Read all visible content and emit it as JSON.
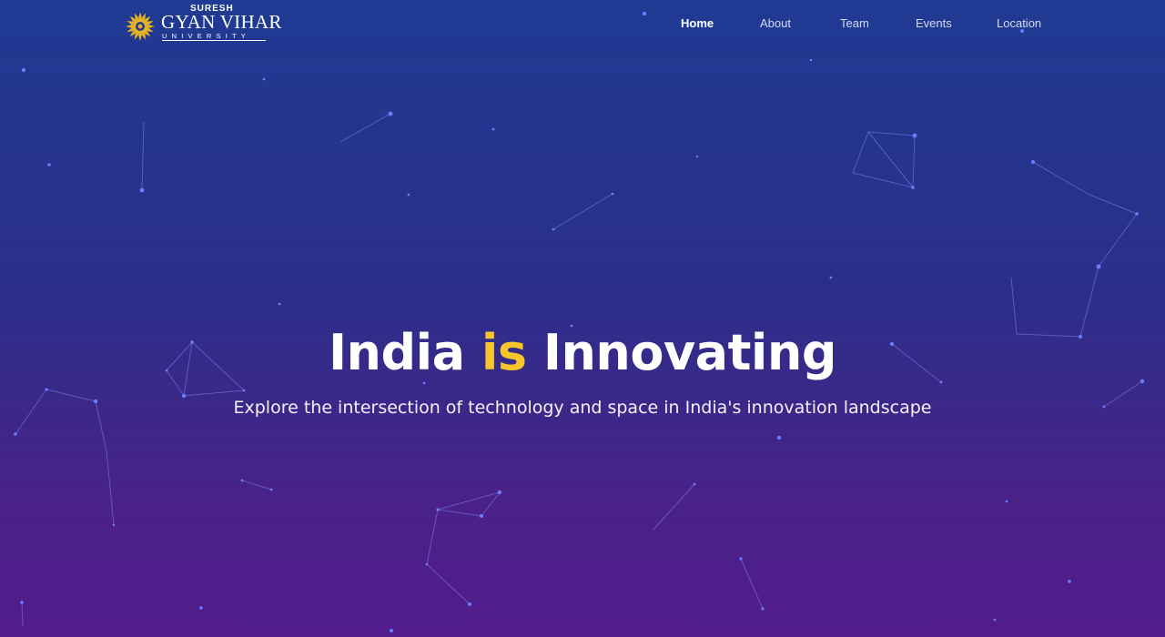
{
  "brand": {
    "top": "SURESH",
    "name": "GYAN VIHAR",
    "sub": "UNIVERSITY",
    "emblem_color": "#e6b422"
  },
  "nav": {
    "items": [
      {
        "label": "Home",
        "active": true
      },
      {
        "label": "About",
        "active": false
      },
      {
        "label": "Team",
        "active": false
      },
      {
        "label": "Events",
        "active": false
      },
      {
        "label": "Location",
        "active": false
      }
    ]
  },
  "hero": {
    "title_before": "India ",
    "title_accent": "is",
    "title_after": " Innovating",
    "subtitle": "Explore the intersection of technology and space in India's innovation landscape"
  },
  "colors": {
    "bg_top": "#1f3a93",
    "bg_bottom": "#521c8c",
    "accent": "#f6c42b",
    "star": "#6b7cff",
    "line": "#8a95ff"
  }
}
